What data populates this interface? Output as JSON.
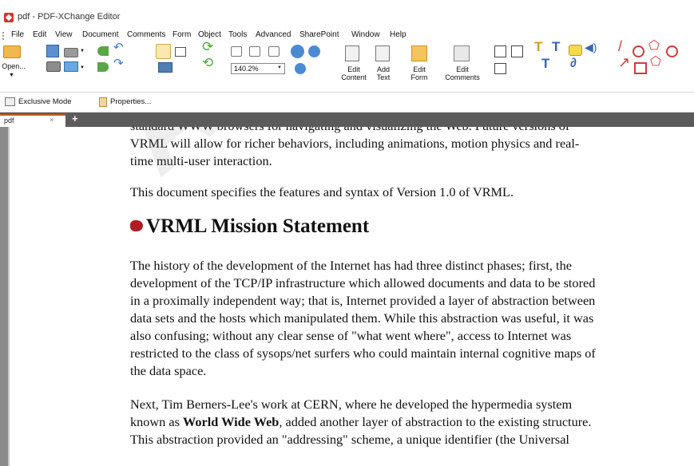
{
  "window": {
    "title": "pdf - PDF-XChange Editor"
  },
  "menu": [
    "File",
    "Edit",
    "View",
    "Document",
    "Comments",
    "Form",
    "Object",
    "Tools",
    "Advanced",
    "SharePoint",
    "Window",
    "Help"
  ],
  "toolbar": {
    "open_label": "Open...",
    "zoom_value": "140.2%",
    "edit_content_label": "Edit\nContent",
    "add_text_label": "Add\nText",
    "edit_form_label": "Edit\nForm",
    "edit_comments_label": "Edit\nComments"
  },
  "quickbar": {
    "exclusive_mode": "Exclusive Mode",
    "properties": "Properties..."
  },
  "tabs": [
    {
      "label": "pdf",
      "close": "×"
    }
  ],
  "tab_add": "+",
  "watermark": "APPRO",
  "document": {
    "top_line": "standard WWW browsers for navigating and visualizing the Web. Future versions of",
    "p1_line1": "VRML will allow for richer behaviors, including animations, motion physics and real-",
    "p1_line2": "time multi-user interaction.",
    "p2": "This document specifies the features and syntax of Version 1.0 of VRML.",
    "heading": "VRML Mission Statement",
    "p3_lines": [
      "The history of the development of the Internet has had three distinct phases; first, the",
      "development of the TCP/IP infrastructure which allowed documents and data to be stored",
      "in a proximally independent way; that is, Internet provided a layer of abstraction between",
      "data sets and the hosts which manipulated them. While this abstraction was useful, it was",
      "also confusing; without any clear sense of \"what went where\", access to Internet was",
      "restricted to the class of sysops/net surfers who could maintain internal cognitive maps of",
      "the data space."
    ],
    "p4_line1": "Next, Tim Berners-Lee's work at CERN, where he developed the hypermedia system",
    "p4_line2_pre": "known as ",
    "p4_line2_bold": "World Wide Web",
    "p4_line2_post": ", added another layer of abstraction to the existing structure.",
    "p4_line3": "This abstraction provided an \"addressing\" scheme, a unique identifier (the Universal"
  },
  "colors": {
    "accent": "#d05a17",
    "tabstrip": "#5b5b5b",
    "bullet": "#b01c24",
    "app_logo": "#d4322b"
  }
}
